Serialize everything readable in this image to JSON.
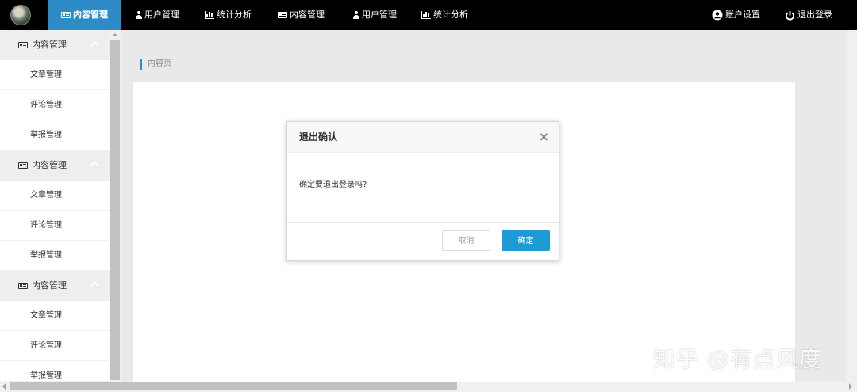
{
  "nav": {
    "items": [
      {
        "label": "内容管理",
        "icon": "card-icon",
        "active": true
      },
      {
        "label": "用户管理",
        "icon": "user-icon"
      },
      {
        "label": "统计分析",
        "icon": "bar-chart-icon"
      },
      {
        "label": "内容管理",
        "icon": "card-icon"
      },
      {
        "label": "用户管理",
        "icon": "user-icon"
      },
      {
        "label": "统计分析",
        "icon": "bar-chart-icon"
      }
    ],
    "account_label": "账户设置",
    "logout_label": "退出登录",
    "active_color": "#2d8cc8"
  },
  "sidebar": {
    "groups": [
      {
        "label": "内容管理",
        "items": [
          "文章管理",
          "评论管理",
          "举报管理"
        ]
      },
      {
        "label": "内容管理",
        "items": [
          "文章管理",
          "评论管理",
          "举报管理"
        ]
      },
      {
        "label": "内容管理",
        "items": [
          "文章管理",
          "评论管理",
          "举报管理"
        ]
      }
    ]
  },
  "breadcrumb": "内容页",
  "dialog": {
    "title": "退出确认",
    "message": "确定要退出登录吗?",
    "cancel_label": "取消",
    "ok_label": "确定",
    "ok_color": "#1e9ad6"
  },
  "watermark": "知乎 @有点风度"
}
